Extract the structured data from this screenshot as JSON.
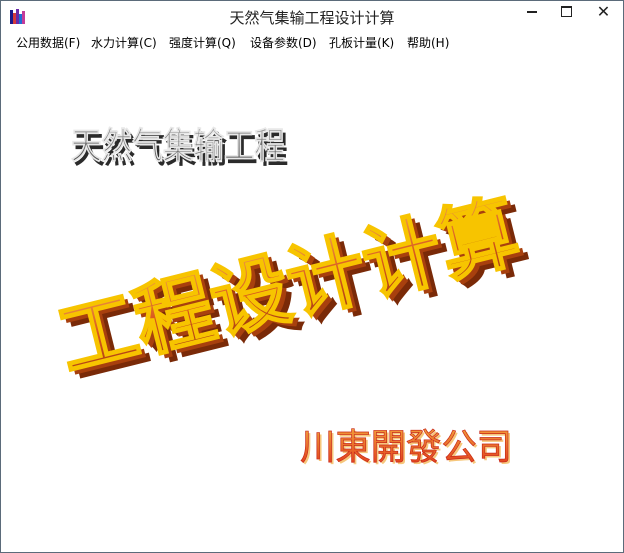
{
  "window": {
    "title": "天然气集输工程设计计算",
    "controls": {
      "minimize": "minimize",
      "maximize": "maximize",
      "close": "✕"
    }
  },
  "menu": {
    "items": [
      {
        "label": "公用数据(F)"
      },
      {
        "label": "水力计算(C)"
      },
      {
        "label": "强度计算(Q)"
      },
      {
        "label": "设备参数(D)"
      },
      {
        "label": "孔板计量(K)"
      },
      {
        "label": "帮助(H)"
      }
    ]
  },
  "splash": {
    "line1": "天然气集输工程",
    "line2": "工程设计计算",
    "company": "川東開發公司",
    "colors": {
      "line1": "#6b6b6b",
      "line2": "#d9622a",
      "line2_outline": "#f7c400",
      "company": "#e4571d"
    }
  }
}
